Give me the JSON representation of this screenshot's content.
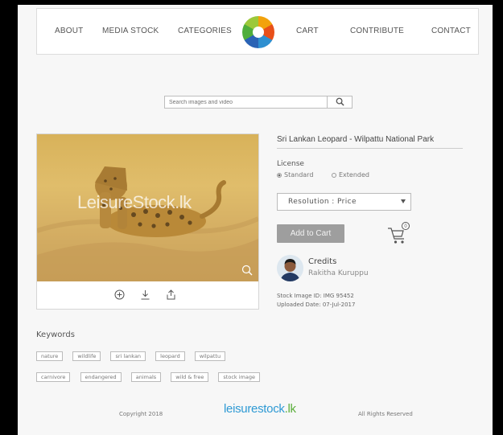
{
  "nav": {
    "about": "ABOUT",
    "media_stock": "MEDIA STOCK",
    "categories": "CATEGORIES",
    "cart": "CART",
    "contribute": "CONTRIBUTE",
    "contact": "CONTACT"
  },
  "search": {
    "placeholder": "Search images and video"
  },
  "image": {
    "watermark": "LeisureStock.lk"
  },
  "product": {
    "title": "Sri Lankan Leopard - Wilpattu National Park",
    "license_label": "License",
    "license_options": [
      "Standard",
      "Extended"
    ],
    "license_selected": "Standard",
    "resolution_label": "Resolution : Price",
    "add_to_cart": "Add to Cart",
    "cart_count": "0"
  },
  "credits": {
    "title": "Credits",
    "name": "Rakitha Kuruppu",
    "stock_image_id": "Stock Image ID: IMG 95452",
    "uploaded_date": "Uploaded Date: 07-Jul-2017"
  },
  "keywords": {
    "label": "Keywords",
    "tags": [
      "nature",
      "wildlife",
      "sri lankan",
      "leopard",
      "wilpattu",
      "carnivore",
      "endangered",
      "animals",
      "wild & free",
      "stock image"
    ]
  },
  "footer": {
    "copyright": "Copyright 2018",
    "logo_text": "leisurestock",
    "logo_suffix": ".lk",
    "rights": "All Rights Reserved"
  },
  "colors": {
    "button_gray": "#9e9e9e",
    "footer_logo_blue": "#2f9ad4",
    "footer_logo_green": "#5aae3a"
  }
}
